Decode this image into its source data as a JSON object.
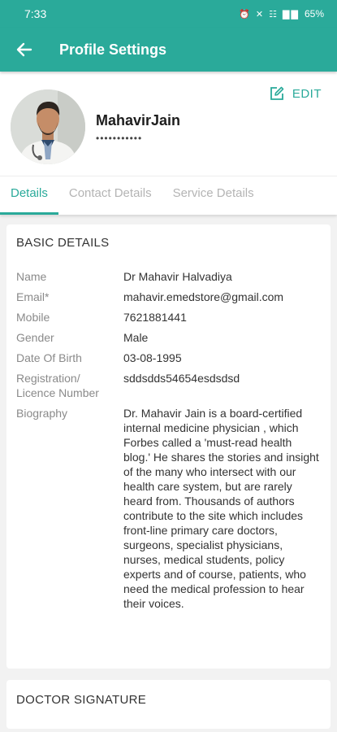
{
  "status_bar": {
    "time": "7:33",
    "icons": "⏰ ✕ ☷ ▇▇",
    "battery": "65%"
  },
  "app_bar": {
    "title": "Profile Settings"
  },
  "profile": {
    "name": "MahavirJain",
    "masked": "•••••••••••",
    "edit_label": "EDIT"
  },
  "tabs": [
    {
      "label": "Details"
    },
    {
      "label": "Contact Details"
    },
    {
      "label": "Service Details"
    }
  ],
  "basic_details": {
    "title": "BASIC DETAILS",
    "rows": [
      {
        "label": "Name",
        "value": "Dr Mahavir Halvadiya"
      },
      {
        "label": "Email*",
        "value": "mahavir.emedstore@gmail.com"
      },
      {
        "label": "Mobile",
        "value": "7621881441"
      },
      {
        "label": "Gender",
        "value": "Male"
      },
      {
        "label": "Date Of Birth",
        "value": "03-08-1995"
      },
      {
        "label": "Registration/ Licence Number",
        "value": "sddsdds54654esdsdsd"
      },
      {
        "label": "Biography",
        "value": "Dr. Mahavir Jain is a board-certified internal medicine physician , which Forbes called a 'must-read health blog.' He shares the stories and insight of the many who intersect with our health care system, but are rarely heard from. Thousands of authors contribute to the site which includes front-line primary care doctors, surgeons, specialist physicians, nurses, medical students, policy experts and of course, patients, who need the medical profession to hear their voices."
      }
    ]
  },
  "signature": {
    "title": "DOCTOR SIGNATURE"
  },
  "colors": {
    "accent": "#2aaa9a"
  }
}
